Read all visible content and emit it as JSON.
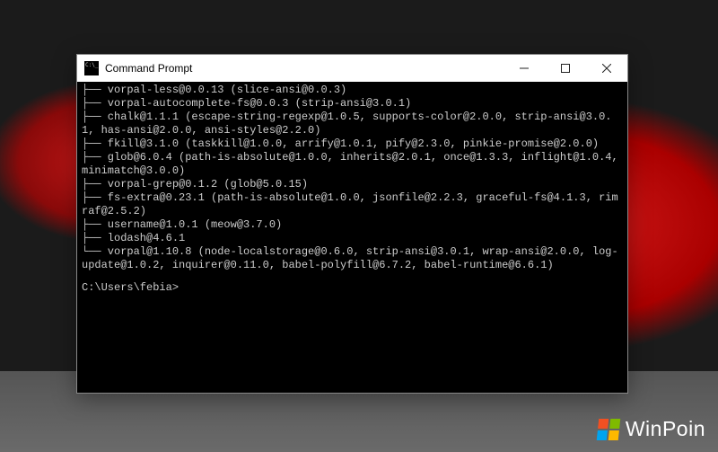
{
  "window": {
    "title": "Command Prompt"
  },
  "terminal": {
    "lines": [
      "├── vorpal-less@0.0.13 (slice-ansi@0.0.3)",
      "├── vorpal-autocomplete-fs@0.0.3 (strip-ansi@3.0.1)",
      "├── chalk@1.1.1 (escape-string-regexp@1.0.5, supports-color@2.0.0, strip-ansi@3.0.1, has-ansi@2.0.0, ansi-styles@2.2.0)",
      "├── fkill@3.1.0 (taskkill@1.0.0, arrify@1.0.1, pify@2.3.0, pinkie-promise@2.0.0)",
      "├── glob@6.0.4 (path-is-absolute@1.0.0, inherits@2.0.1, once@1.3.3, inflight@1.0.4, minimatch@3.0.0)",
      "├── vorpal-grep@0.1.2 (glob@5.0.15)",
      "├── fs-extra@0.23.1 (path-is-absolute@1.0.0, jsonfile@2.2.3, graceful-fs@4.1.3, rimraf@2.5.2)",
      "├── username@1.0.1 (meow@3.7.0)",
      "├── lodash@4.6.1",
      "└── vorpal@1.10.8 (node-localstorage@0.6.0, strip-ansi@3.0.1, wrap-ansi@2.0.0, log-update@1.0.2, inquirer@0.11.0, babel-polyfill@6.7.2, babel-runtime@6.6.1)"
    ],
    "prompt": "C:\\Users\\febia>"
  },
  "watermark": {
    "text": "WinPoin"
  }
}
